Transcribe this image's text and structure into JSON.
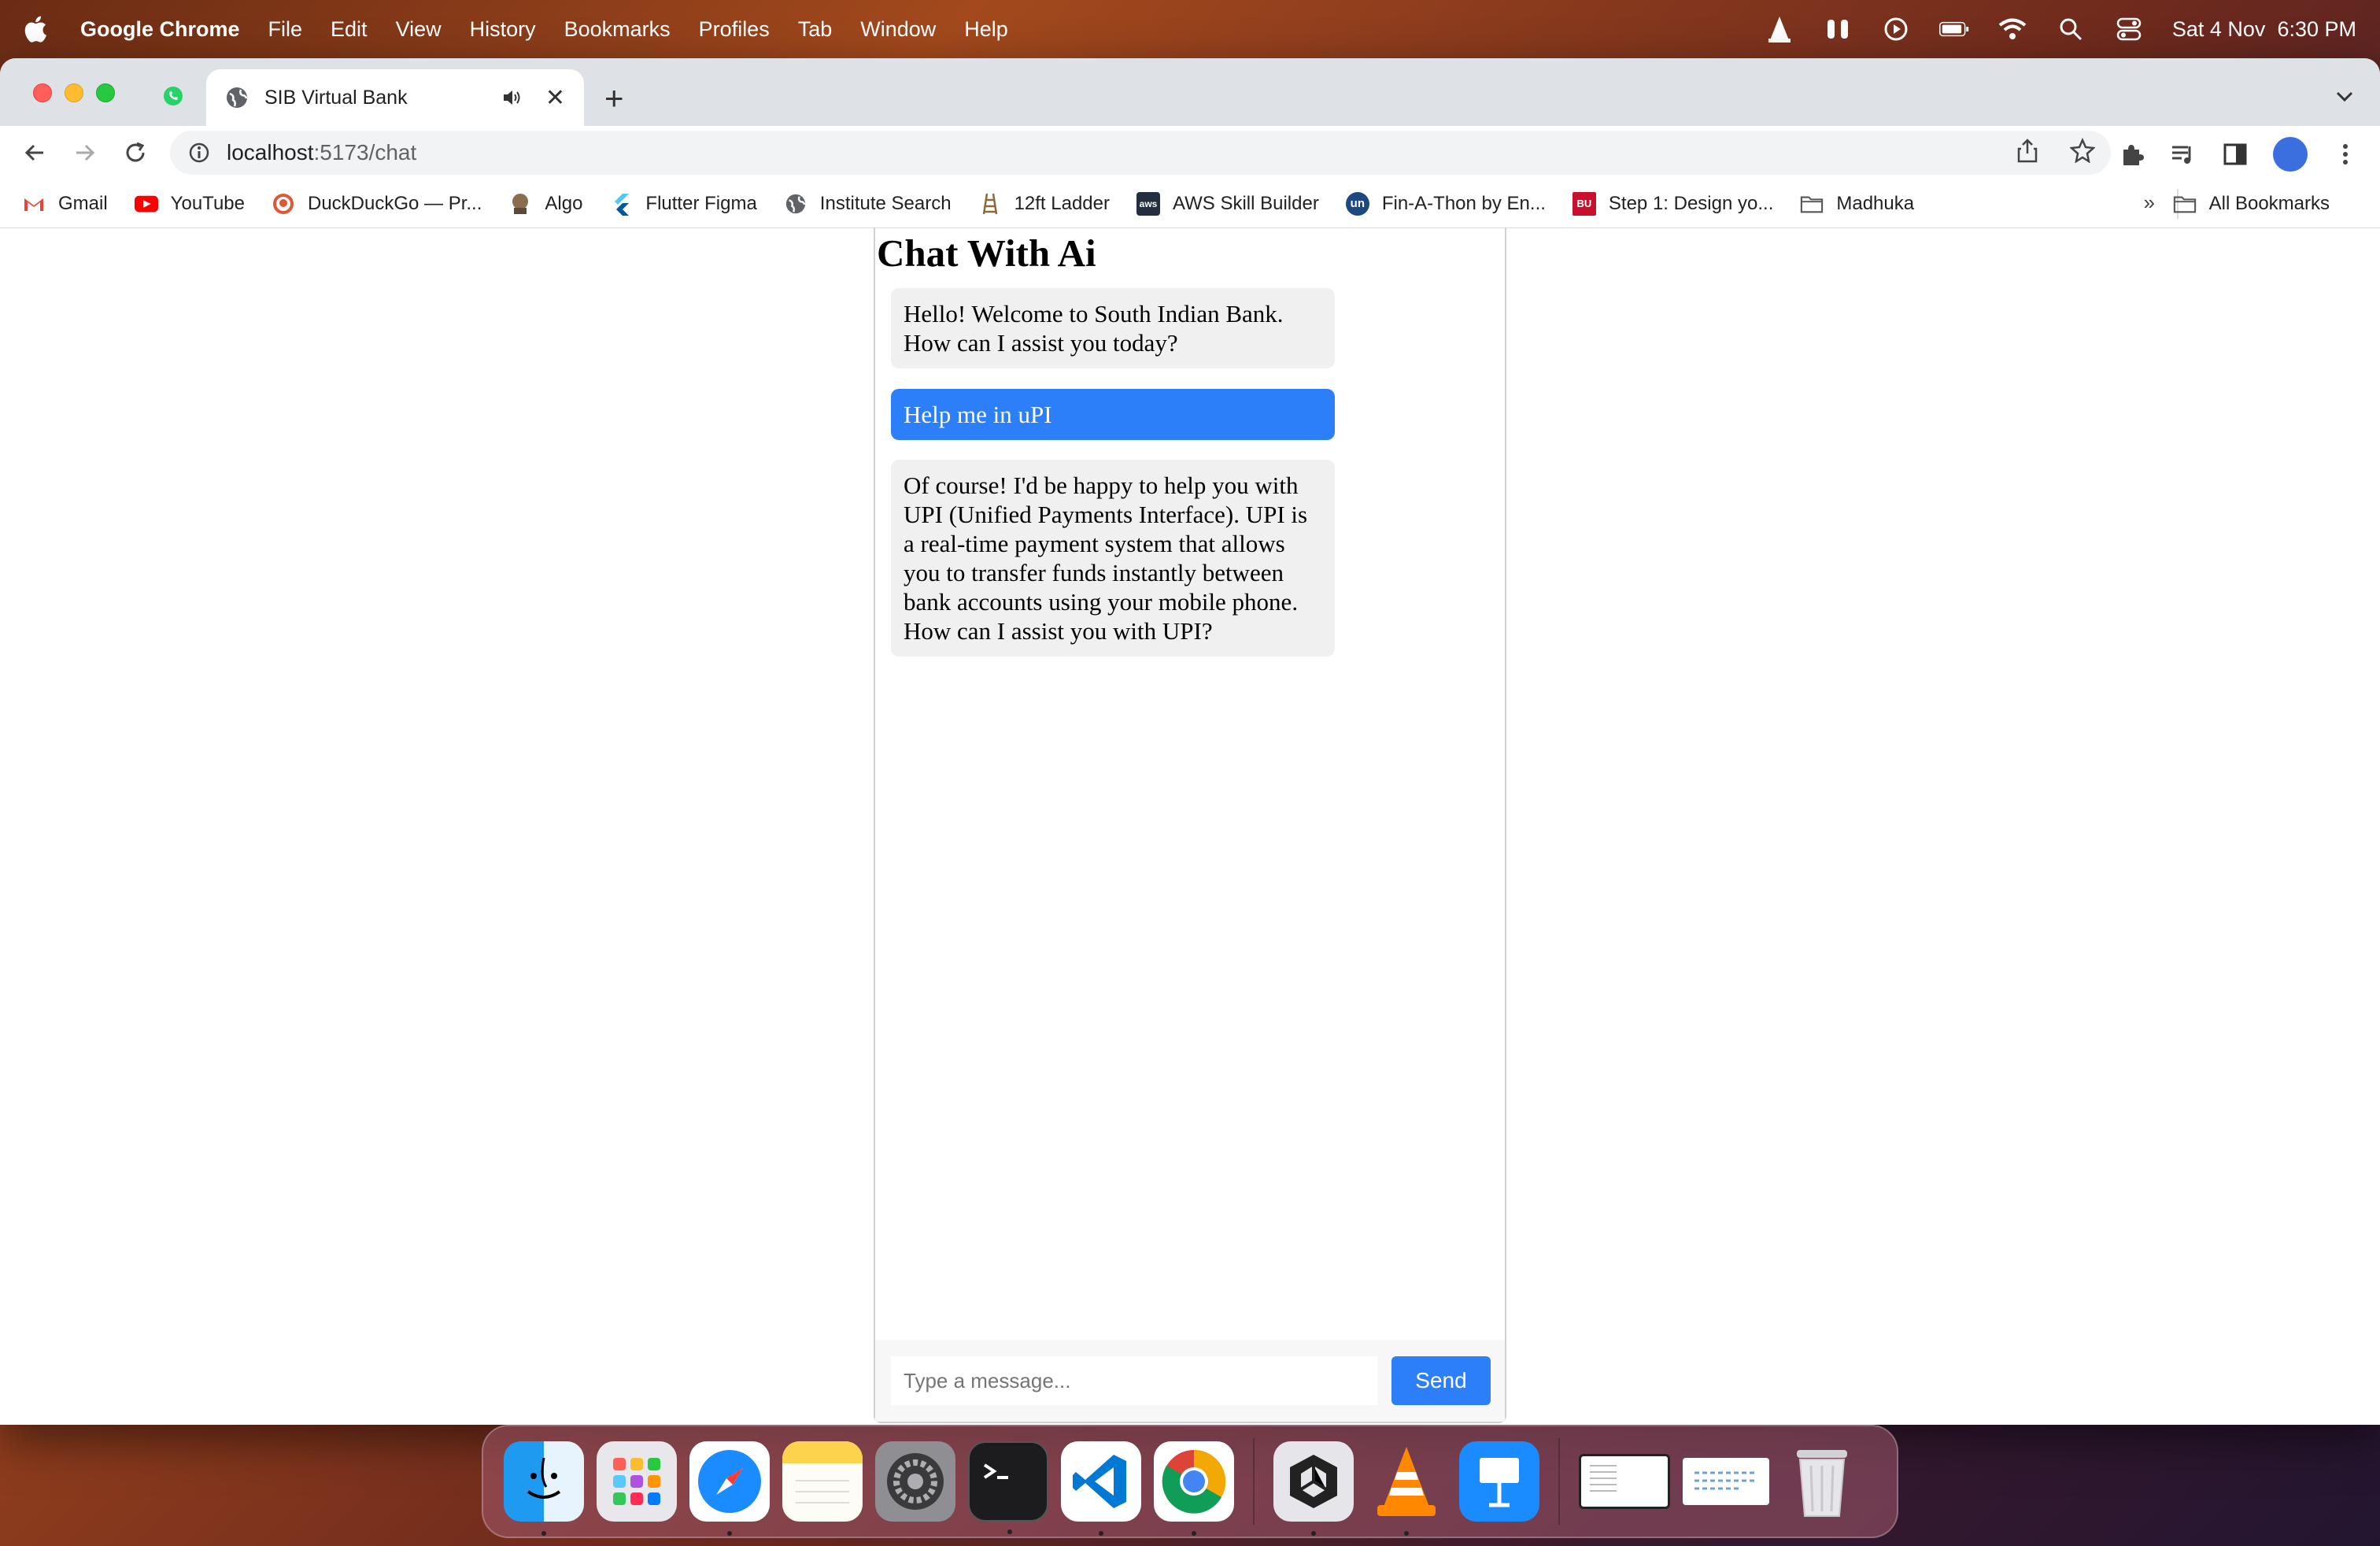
{
  "menubar": {
    "app_name": "Google Chrome",
    "items": [
      "File",
      "Edit",
      "View",
      "History",
      "Bookmarks",
      "Profiles",
      "Tab",
      "Window",
      "Help"
    ],
    "datetime": "Sat 4 Nov  6:30 PM"
  },
  "browser": {
    "tab_title": "SIB Virtual Bank",
    "url_host": "localhost",
    "url_path": ":5173/chat",
    "bookmarks": [
      {
        "label": "Gmail",
        "icon": "gmail-icon"
      },
      {
        "label": "YouTube",
        "icon": "youtube-icon"
      },
      {
        "label": "DuckDuckGo — Pr...",
        "icon": "duckduckgo-icon"
      },
      {
        "label": "Algo",
        "icon": "algo-icon"
      },
      {
        "label": "Flutter Figma",
        "icon": "flutter-icon"
      },
      {
        "label": "Institute Search",
        "icon": "globe-icon"
      },
      {
        "label": "12ft Ladder",
        "icon": "ladder-icon"
      },
      {
        "label": "AWS Skill Builder",
        "icon": "aws-icon"
      },
      {
        "label": "Fin-A-Thon by En...",
        "icon": "unstop-icon"
      },
      {
        "label": "Step 1: Design yo...",
        "icon": "bu-icon"
      },
      {
        "label": "Madhuka",
        "icon": "folder-icon"
      }
    ],
    "more_bookmarks": "»",
    "all_bookmarks": "All Bookmarks"
  },
  "chat": {
    "title": "Chat With Ai",
    "messages": [
      {
        "role": "bot",
        "text": "Hello! Welcome to South Indian Bank. How can I assist you today?"
      },
      {
        "role": "user",
        "text": "Help me in uPI"
      },
      {
        "role": "bot",
        "text": "Of course! I'd be happy to help you with UPI (Unified Payments Interface). UPI is a real-time payment system that allows you to transfer funds instantly between bank accounts using your mobile phone. How can I assist you with UPI?"
      }
    ],
    "input_placeholder": "Type a message...",
    "send_label": "Send"
  },
  "dock": {
    "apps": [
      "finder-icon",
      "launchpad-icon",
      "safari-icon",
      "notes-icon",
      "system-settings-icon",
      "terminal-icon",
      "vscode-icon",
      "chrome-icon",
      "unity-icon",
      "vlc-icon",
      "keynote-icon"
    ]
  },
  "colors": {
    "accent": "#2d7ff9",
    "bot_bubble": "#f0f0f0"
  }
}
